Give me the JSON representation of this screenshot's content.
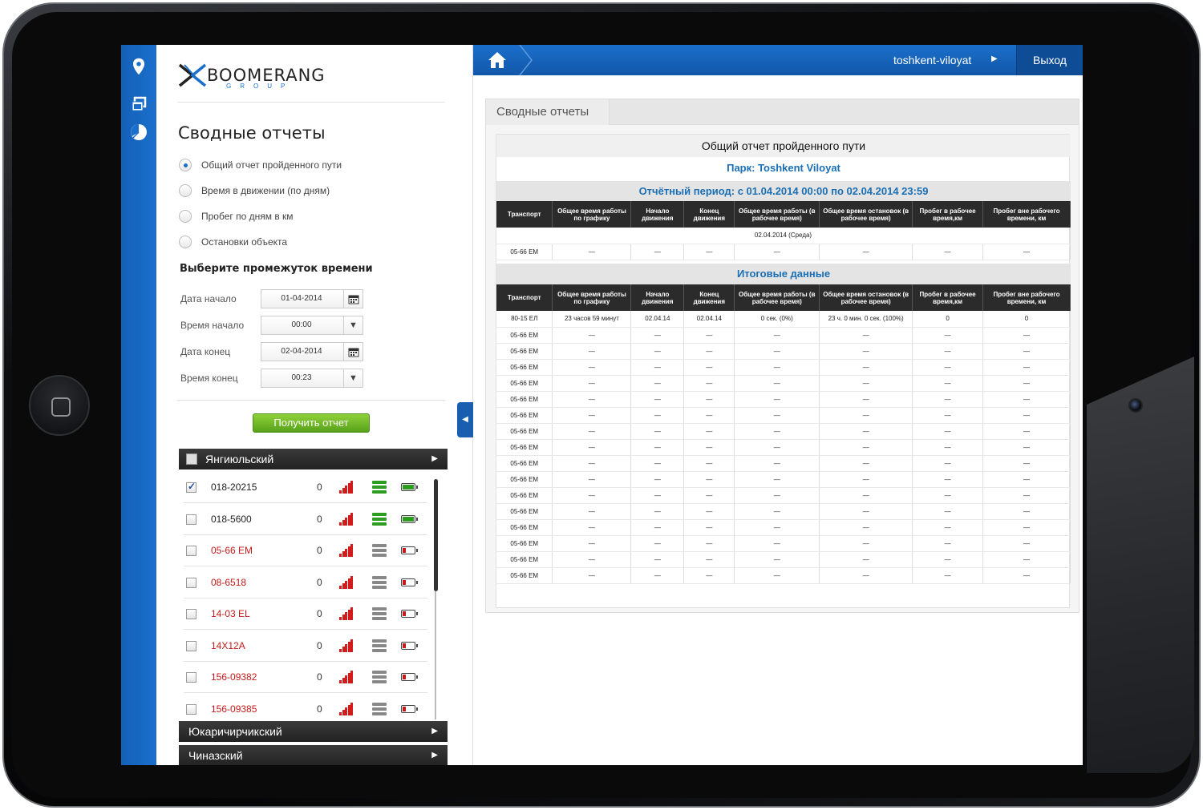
{
  "brand": {
    "name": "BOOMERANG",
    "sub": "GROUP"
  },
  "sidebar_icons": [
    "map-pin-icon",
    "windows-icon",
    "pie-chart-icon"
  ],
  "left_panel": {
    "title": "Сводные отчеты",
    "report_types": [
      {
        "label": "Общий отчет пройденного пути",
        "selected": true
      },
      {
        "label": "Время в движении (по дням)",
        "selected": false
      },
      {
        "label": "Пробег по дням в км",
        "selected": false
      },
      {
        "label": "Остановки объекта",
        "selected": false
      }
    ],
    "period_title": "Выберите промежуток времени",
    "fields": {
      "start_date_label": "Дата начало",
      "start_date": "01-04-2014",
      "start_time_label": "Время начало",
      "start_time": "00:00",
      "end_date_label": "Дата конец",
      "end_date": "02-04-2014",
      "end_time_label": "Время конец",
      "end_time": "00:23"
    },
    "get_report": "Получить отчет",
    "groups": [
      {
        "name": "Янгиюльский",
        "expanded": true
      },
      {
        "name": "Юкаричирчикский",
        "expanded": false
      },
      {
        "name": "Чиназский",
        "expanded": false
      }
    ],
    "vehicles": [
      {
        "name": "018-20215",
        "count": "0",
        "checked": true,
        "status": "online"
      },
      {
        "name": "018-5600",
        "count": "0",
        "checked": false,
        "status": "online"
      },
      {
        "name": "05-66 EM",
        "count": "0",
        "checked": false,
        "status": "offline"
      },
      {
        "name": "08-6518",
        "count": "0",
        "checked": false,
        "status": "offline"
      },
      {
        "name": "14-03 EL",
        "count": "0",
        "checked": false,
        "status": "offline"
      },
      {
        "name": "14X12A",
        "count": "0",
        "checked": false,
        "status": "offline"
      },
      {
        "name": "156-09382",
        "count": "0",
        "checked": false,
        "status": "offline"
      },
      {
        "name": "156-09385",
        "count": "0",
        "checked": false,
        "status": "offline"
      }
    ],
    "colors": {
      "online": "#2e9c1f",
      "offline": "#888888",
      "alert": "#c41a1a"
    }
  },
  "topbar": {
    "user": "toshkent-viloyat",
    "exit": "Выход"
  },
  "report": {
    "tab": "Сводные отчеты",
    "title": "Общий отчет пройденного пути",
    "park": "Парк: Toshkent Viloyat",
    "period": "Отчётный период:  с 01.04.2014 00:00 по 02.04.2014 23:59",
    "columns": [
      "Транспорт",
      "Общее время работы по графику",
      "Начало движения",
      "Конец движения",
      "Общее время работы (в рабочее время)",
      "Общее время остановок (в рабочее время)",
      "Пробег в рабочее время,км",
      "Пробег вне рабочего времени, км"
    ],
    "day_label": "02.04.2014 (Среда)",
    "day_rows": [
      [
        "05-66 EM",
        "—",
        "—",
        "—",
        "—",
        "—",
        "—",
        "—"
      ]
    ],
    "summary_title": "Итоговые данные",
    "summary_rows": [
      [
        "80-15 ЕЛ",
        "23 часов 59 минут",
        "02.04.14",
        "02.04.14",
        "0 сек. (0%)",
        "23 ч. 0 мин. 0 сек. (100%)",
        "0",
        "0"
      ],
      [
        "05-66 EM",
        "—",
        "—",
        "—",
        "—",
        "—",
        "—",
        "—"
      ],
      [
        "05-66 EM",
        "—",
        "—",
        "—",
        "—",
        "—",
        "—",
        "—"
      ],
      [
        "05-66 EM",
        "—",
        "—",
        "—",
        "—",
        "—",
        "—",
        "—"
      ],
      [
        "05-66 EM",
        "—",
        "—",
        "—",
        "—",
        "—",
        "—",
        "—"
      ],
      [
        "05-66 EM",
        "—",
        "—",
        "—",
        "—",
        "—",
        "—",
        "—"
      ],
      [
        "05-66 EM",
        "—",
        "—",
        "—",
        "—",
        "—",
        "—",
        "—"
      ],
      [
        "05-66 EM",
        "—",
        "—",
        "—",
        "—",
        "—",
        "—",
        "—"
      ],
      [
        "05-66 EM",
        "—",
        "—",
        "—",
        "—",
        "—",
        "—",
        "—"
      ],
      [
        "05-66 EM",
        "—",
        "—",
        "—",
        "—",
        "—",
        "—",
        "—"
      ],
      [
        "05-66 EM",
        "—",
        "—",
        "—",
        "—",
        "—",
        "—",
        "—"
      ],
      [
        "05-66 EM",
        "—",
        "—",
        "—",
        "—",
        "—",
        "—",
        "—"
      ],
      [
        "05-66 EM",
        "—",
        "—",
        "—",
        "—",
        "—",
        "—",
        "—"
      ],
      [
        "05-66 EM",
        "—",
        "—",
        "—",
        "—",
        "—",
        "—",
        "—"
      ],
      [
        "05-66 EM",
        "—",
        "—",
        "—",
        "—",
        "—",
        "—",
        "—"
      ],
      [
        "05-66 EM",
        "—",
        "—",
        "—",
        "—",
        "—",
        "—",
        "—"
      ],
      [
        "05-66 EM",
        "—",
        "—",
        "—",
        "—",
        "—",
        "—",
        "—"
      ]
    ]
  }
}
